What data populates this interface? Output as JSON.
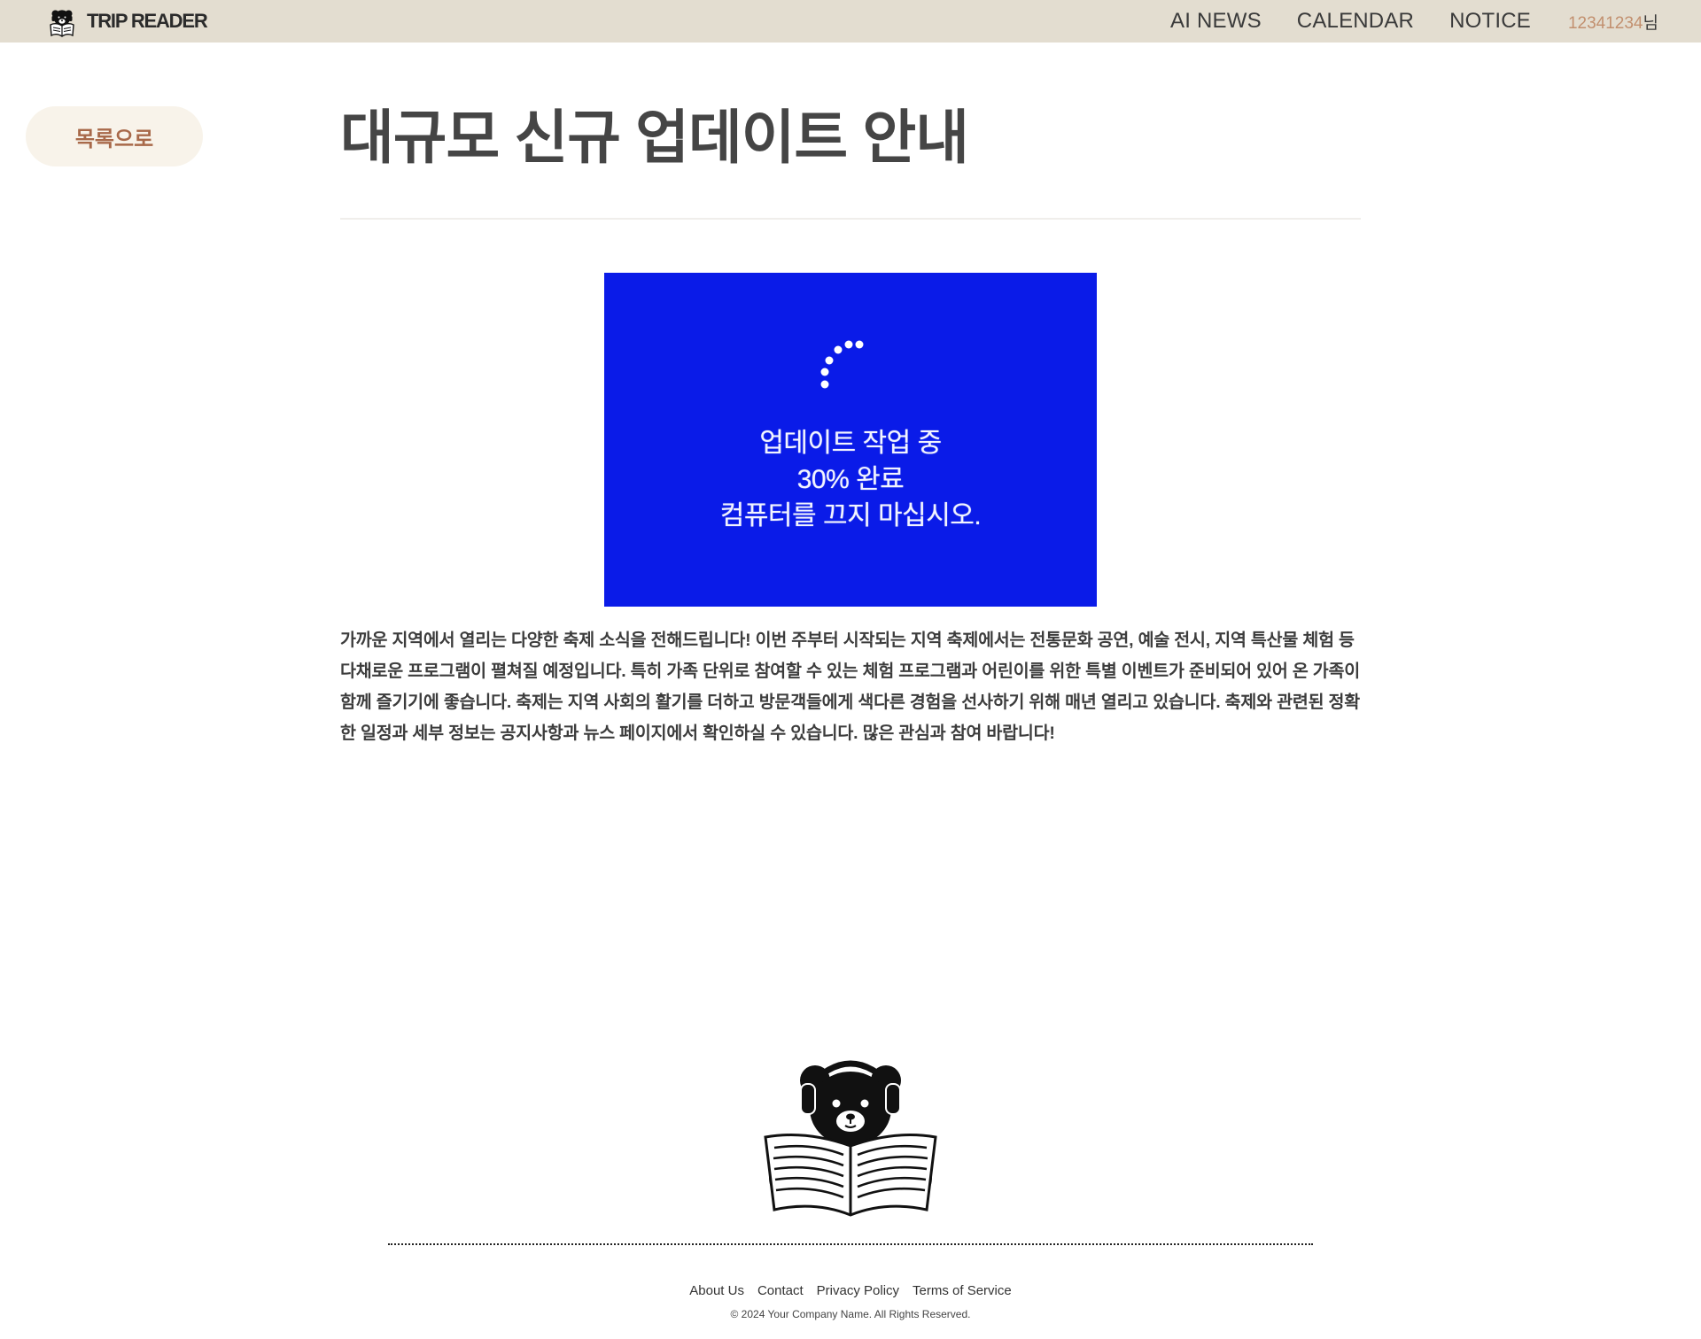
{
  "header": {
    "brand_name": "TRIP READER",
    "logo_icon": "bear-reading-newspaper-icon",
    "background": "#e3ddd0",
    "nav": [
      {
        "label": "AI NEWS"
      },
      {
        "label": "CALENDAR"
      },
      {
        "label": "NOTICE"
      }
    ],
    "user": {
      "name": "12341234",
      "suffix": "님",
      "name_color": "#c2906f"
    }
  },
  "sidebar": {
    "back_label": "목록으로"
  },
  "article": {
    "title": "대규모 신규 업데이트 안내",
    "image": {
      "background": "#0a1be8",
      "icon": "loading-spinner-icon",
      "lines": [
        "업데이트 작업 중",
        "30% 완료",
        "컴퓨터를 끄지 마십시오."
      ]
    },
    "body": "가까운 지역에서 열리는 다양한 축제 소식을 전해드립니다! 이번 주부터 시작되는 지역 축제에서는 전통문화 공연, 예술 전시, 지역 특산물 체험 등 다채로운 프로그램이 펼쳐질 예정입니다. 특히 가족 단위로 참여할 수 있는 체험 프로그램과 어린이를 위한 특별 이벤트가 준비되어 있어 온 가족이 함께 즐기기에 좋습니다. 축제는 지역 사회의 활기를 더하고 방문객들에게 색다른 경험을 선사하기 위해 매년 열리고 있습니다. 축제와 관련된 정확한 일정과 세부 정보는 공지사항과 뉴스 페이지에서 확인하실 수 있습니다. 많은 관심과 참여 바랍니다!"
  },
  "footer": {
    "mascot_icon": "bear-with-headphones-reading-newspaper-icon",
    "links": [
      {
        "label": "About Us"
      },
      {
        "label": "Contact"
      },
      {
        "label": "Privacy Policy"
      },
      {
        "label": "Terms of Service"
      }
    ],
    "copyright": "© 2024 Your Company Name. All Rights Reserved."
  }
}
